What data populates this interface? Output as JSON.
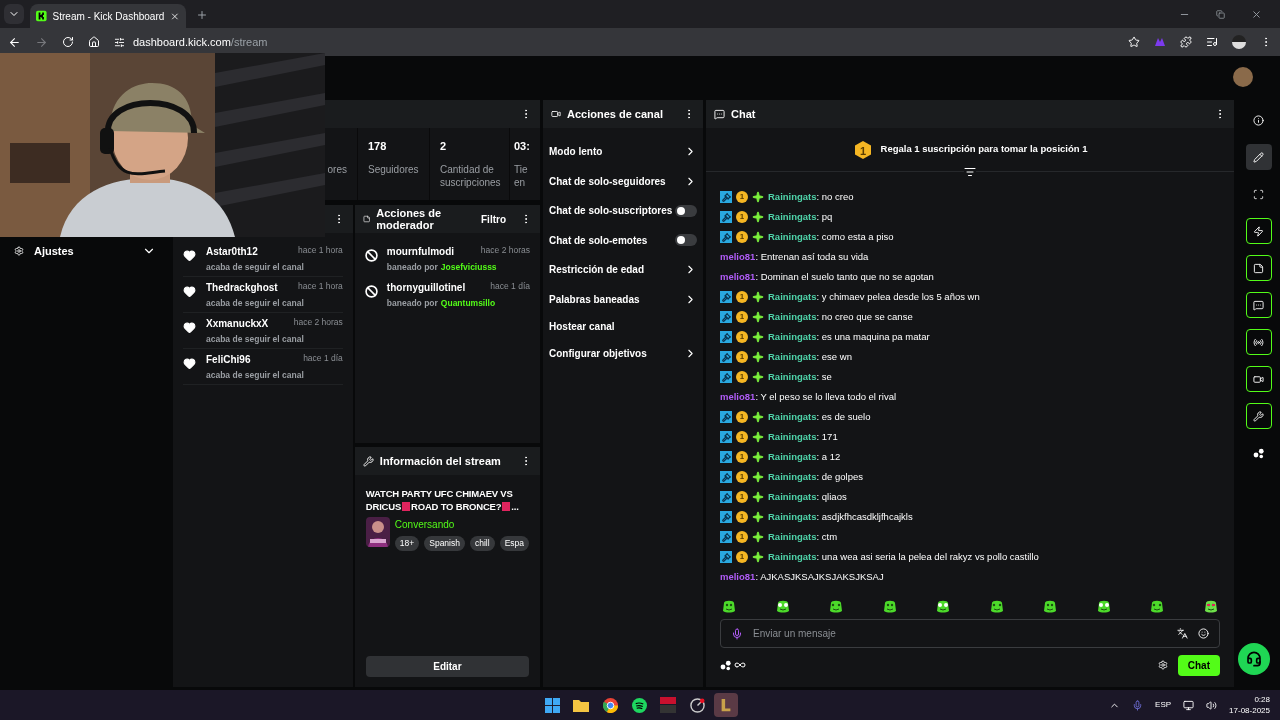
{
  "browser": {
    "tab_title": "Stream - Kick Dashboard",
    "url_host": "dashboard.kick.com",
    "url_path": "/stream",
    "forward_disabled": true
  },
  "sidebar": {
    "label": "Ajustes"
  },
  "stats": {
    "items": [
      {
        "value": "",
        "label": "ores"
      },
      {
        "value": "178",
        "label": "Seguidores"
      },
      {
        "value": "2",
        "label": "Cantidad de suscripciones"
      },
      {
        "value": "03:",
        "label": "Tie en"
      }
    ]
  },
  "followers": {
    "items": [
      {
        "name": "Astar0th12",
        "time": "hace 1 hora",
        "note": "acaba de seguir el canal"
      },
      {
        "name": "Thedrackghost",
        "time": "hace 1 hora",
        "note": "acaba de seguir el canal"
      },
      {
        "name": "XxmanuckxX",
        "time": "hace 2 horas",
        "note": "acaba de seguir el canal"
      },
      {
        "name": "FeliChi96",
        "time": "hace 1 día",
        "note": "acaba de seguir el canal"
      }
    ]
  },
  "mod_actions": {
    "title": "Acciones de moderador",
    "filter": "Filtro",
    "items": [
      {
        "name": "mournfulmodi",
        "time": "hace 2 horas",
        "action": "baneado por",
        "by": "Josefviciusss"
      },
      {
        "name": "thornyguillotinel",
        "time": "hace 1 día",
        "action": "baneado por",
        "by": "Quantumsillo"
      }
    ]
  },
  "stream_info": {
    "title": "Información del stream",
    "stream_title": [
      "WATCH PARTY UFC CHIMAEV VS DRICUS",
      "ROAD TO BRONCE?",
      "..."
    ],
    "category": "Conversando",
    "tags": [
      "18+",
      "Spanish",
      "chill",
      "Espa"
    ],
    "edit": "Editar"
  },
  "channel_actions": {
    "title": "Acciones de canal",
    "items": [
      {
        "kind": "link",
        "label": "Modo lento"
      },
      {
        "kind": "link",
        "label": "Chat de solo-seguidores"
      },
      {
        "kind": "toggle",
        "label": "Chat de solo-suscriptores",
        "on": false
      },
      {
        "kind": "toggle",
        "label": "Chat de solo-emotes",
        "on": false
      },
      {
        "kind": "link",
        "label": "Restricción de edad"
      },
      {
        "kind": "link",
        "label": "Palabras baneadas"
      },
      {
        "kind": "plain",
        "label": "Hostear canal"
      },
      {
        "kind": "link",
        "label": "Configurar objetivos"
      }
    ]
  },
  "chat": {
    "title": "Chat",
    "gift_rank": "1",
    "gift_text": "Regala 1 suscripción para tomar la posición 1",
    "messages": [
      {
        "kind": "sub",
        "badge": "1",
        "user": "Rainingats",
        "color": "#4fd3a9",
        "text": ": no creo"
      },
      {
        "kind": "sub",
        "badge": "1",
        "user": "Rainingats",
        "color": "#4fd3a9",
        "text": ": pq"
      },
      {
        "kind": "sub",
        "badge": "1",
        "user": "Rainingats",
        "color": "#4fd3a9",
        "text": ": como esta a piso"
      },
      {
        "kind": "plain",
        "user": "melio81",
        "color": "#b05cf6",
        "text": ": Entrenan así toda su vida"
      },
      {
        "kind": "plain",
        "user": "melio81",
        "color": "#b05cf6",
        "text": ": Dominan el suelo tanto que no se agotan"
      },
      {
        "kind": "sub",
        "badge": "1",
        "user": "Rainingats",
        "color": "#4fd3a9",
        "text": ": y chimaev pelea desde los 5 años wn"
      },
      {
        "kind": "sub",
        "badge": "1",
        "user": "Rainingats",
        "color": "#4fd3a9",
        "text": ": no creo que se canse"
      },
      {
        "kind": "sub",
        "badge": "1",
        "user": "Rainingats",
        "color": "#4fd3a9",
        "text": ": es una maquina pa matar"
      },
      {
        "kind": "sub",
        "badge": "1",
        "user": "Rainingats",
        "color": "#4fd3a9",
        "text": ": ese wn"
      },
      {
        "kind": "sub",
        "badge": "1",
        "user": "Rainingats",
        "color": "#4fd3a9",
        "text": ": se"
      },
      {
        "kind": "plain",
        "user": "melio81",
        "color": "#b05cf6",
        "text": ": Y el peso se lo lleva todo el rival"
      },
      {
        "kind": "sub",
        "badge": "1",
        "user": "Rainingats",
        "color": "#4fd3a9",
        "text": ": es de suelo"
      },
      {
        "kind": "sub",
        "badge": "1",
        "user": "Rainingats",
        "color": "#4fd3a9",
        "text": ": 171"
      },
      {
        "kind": "sub",
        "badge": "1",
        "user": "Rainingats",
        "color": "#4fd3a9",
        "text": ": a 12"
      },
      {
        "kind": "sub",
        "badge": "1",
        "user": "Rainingats",
        "color": "#4fd3a9",
        "text": ": de golpes"
      },
      {
        "kind": "sub",
        "badge": "1",
        "user": "Rainingats",
        "color": "#4fd3a9",
        "text": ": qliaos"
      },
      {
        "kind": "sub",
        "badge": "1",
        "user": "Rainingats",
        "color": "#4fd3a9",
        "text": ": asdjkfhcasdkljfhcajkls"
      },
      {
        "kind": "sub",
        "badge": "1",
        "user": "Rainingats",
        "color": "#4fd3a9",
        "text": ": ctm"
      },
      {
        "kind": "sub",
        "badge": "1",
        "user": "Rainingats",
        "color": "#4fd3a9",
        "text": ": una wea asi seria la pelea del rakyz vs pollo castillo"
      },
      {
        "kind": "plain",
        "user": "melio81",
        "color": "#b05cf6",
        "text": ": AJKASJKSAJKSJAKSJKSAJ"
      }
    ],
    "placeholder": "Enviar un mensaje",
    "send": "Chat"
  },
  "rail": [
    {
      "kind": "plain",
      "selected": false
    },
    {
      "kind": "plain",
      "selected": true
    },
    {
      "kind": "plain",
      "selected": false
    },
    {
      "kind": "action",
      "selected": false
    },
    {
      "kind": "action",
      "selected": false
    },
    {
      "kind": "action",
      "selected": false
    },
    {
      "kind": "action",
      "selected": false
    },
    {
      "kind": "action",
      "selected": false
    },
    {
      "kind": "action",
      "selected": false
    },
    {
      "kind": "plain",
      "selected": false
    }
  ],
  "taskbar": {
    "language": "ESP",
    "time": "0:28",
    "date": "17-08-2025"
  }
}
